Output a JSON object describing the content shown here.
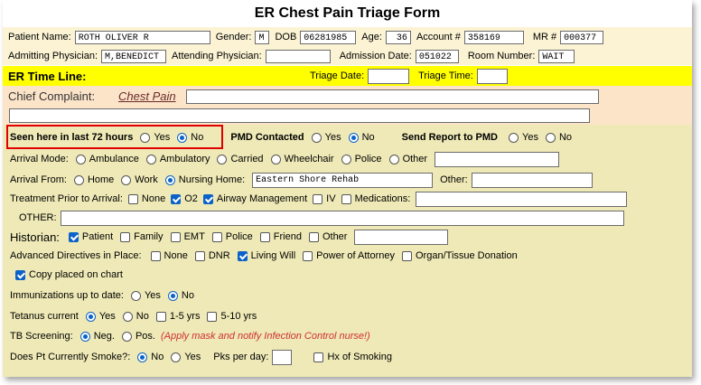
{
  "title": "ER Chest Pain Triage Form",
  "patient": {
    "name_label": "Patient Name:",
    "name_value": "ROTH OLIVER R",
    "gender_label": "Gender:",
    "gender_value": "M",
    "dob_label": "DOB",
    "dob_value": "06281985",
    "age_label": "Age:",
    "age_value": "36",
    "account_label": "Account #",
    "account_value": "358169",
    "mr_label": "MR #",
    "mr_value": "000377"
  },
  "physicians": {
    "admitting_label": "Admitting Physician:",
    "admitting_value": "M,BENEDICT",
    "attending_label": "Attending Physician:",
    "attending_value": "",
    "admission_date_label": "Admission Date:",
    "admission_date_value": "051022",
    "room_label": "Room Number:",
    "room_value": "WAIT"
  },
  "timeline": {
    "label": "ER Time Line:",
    "triage_date_label": "Triage Date:",
    "triage_time_label": "Triage Time:"
  },
  "complaint": {
    "label": "Chief Complaint:",
    "value_link": "Chest Pain"
  },
  "seen72": {
    "label": "Seen here in last 72 hours",
    "yes": "Yes",
    "no": "No"
  },
  "pmd": {
    "label": "PMD Contacted",
    "yes": "Yes",
    "no": "No"
  },
  "report": {
    "label": "Send Report to PMD",
    "yes": "Yes",
    "no": "No"
  },
  "arrival_mode": {
    "label": "Arrival Mode:",
    "options": [
      "Ambulance",
      "Ambulatory",
      "Carried",
      "Wheelchair",
      "Police",
      "Other"
    ]
  },
  "arrival_from": {
    "label": "Arrival From:",
    "options": [
      "Home",
      "Work",
      "Nursing Home:"
    ],
    "nursing_home_value": "Eastern Shore Rehab",
    "other_label": "Other:"
  },
  "treatment": {
    "label": "Treatment Prior to Arrival:",
    "options": [
      "None",
      "O2",
      "Airway Management",
      "IV",
      "Medications:"
    ],
    "other_label": "OTHER:"
  },
  "historian": {
    "label": "Historian:",
    "options": [
      "Patient",
      "Family",
      "EMT",
      "Police",
      "Friend",
      "Other"
    ]
  },
  "directives": {
    "label": "Advanced Directives in Place:",
    "options": [
      "None",
      "DNR",
      "Living Will",
      "Power of Attorney",
      "Organ/Tissue Donation"
    ],
    "copy_label": "Copy placed on chart"
  },
  "immunizations": {
    "label": "Immunizations up to date:",
    "yes": "Yes",
    "no": "No"
  },
  "tetanus": {
    "label": "Tetanus current",
    "yes": "Yes",
    "no": "No",
    "opt1": "1-5 yrs",
    "opt2": "5-10 yrs"
  },
  "tb": {
    "label": "TB Screening:",
    "neg": "Neg.",
    "pos": "Pos.",
    "note": "(Apply mask and notify Infection Control nurse!)"
  },
  "smoke": {
    "label": "Does Pt Currently Smoke?:",
    "no": "No",
    "yes": "Yes",
    "pks_label": "Pks per day:",
    "hx_label": "Hx of Smoking"
  },
  "colors": {
    "accent": "#0b62c8",
    "highlight": "#e00000",
    "yellow_bar": "#ffff00"
  }
}
